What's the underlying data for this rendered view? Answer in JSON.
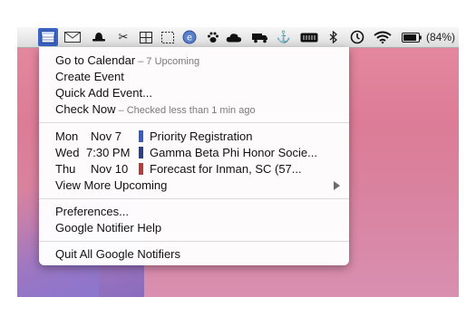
{
  "menubar": {
    "icons": [
      "calendar-icon",
      "mail-icon",
      "hat-icon",
      "scissors-icon",
      "grid-icon",
      "selection-icon",
      "e-circle-icon",
      "paw-icon",
      "cloud-icon",
      "truck-icon",
      "anchor-icon",
      "battery-device-icon",
      "bluetooth-icon",
      "time-machine-icon",
      "wifi-icon",
      "battery-icon"
    ],
    "battery_percent": "(84%)",
    "colors": {
      "active_icon_bg": "#3b63c4"
    }
  },
  "menu": {
    "go_to_calendar": "Go to Calendar",
    "go_to_calendar_sub": " – 7 Upcoming",
    "create_event": "Create Event",
    "quick_add_event": "Quick Add Event...",
    "check_now": "Check Now",
    "check_now_sub": " – Checked less than 1 min ago",
    "events": [
      {
        "day": "Mon",
        "time": "",
        "date": "Nov 7",
        "title": "Priority Registration",
        "color": "#3a5bc4"
      },
      {
        "day": "Wed",
        "time": "7:30 PM",
        "date": "",
        "title": "Gamma Beta Phi Honor Socie...",
        "color": "#2a3f85"
      },
      {
        "day": "Thu",
        "time": "",
        "date": "Nov 10",
        "title": "Forecast for Inman, SC (57...",
        "color": "#b83a3a"
      }
    ],
    "view_more_upcoming": "View More Upcoming",
    "preferences": "Preferences...",
    "notifier_help": "Google Notifier Help",
    "quit": "Quit All Google Notifiers"
  }
}
